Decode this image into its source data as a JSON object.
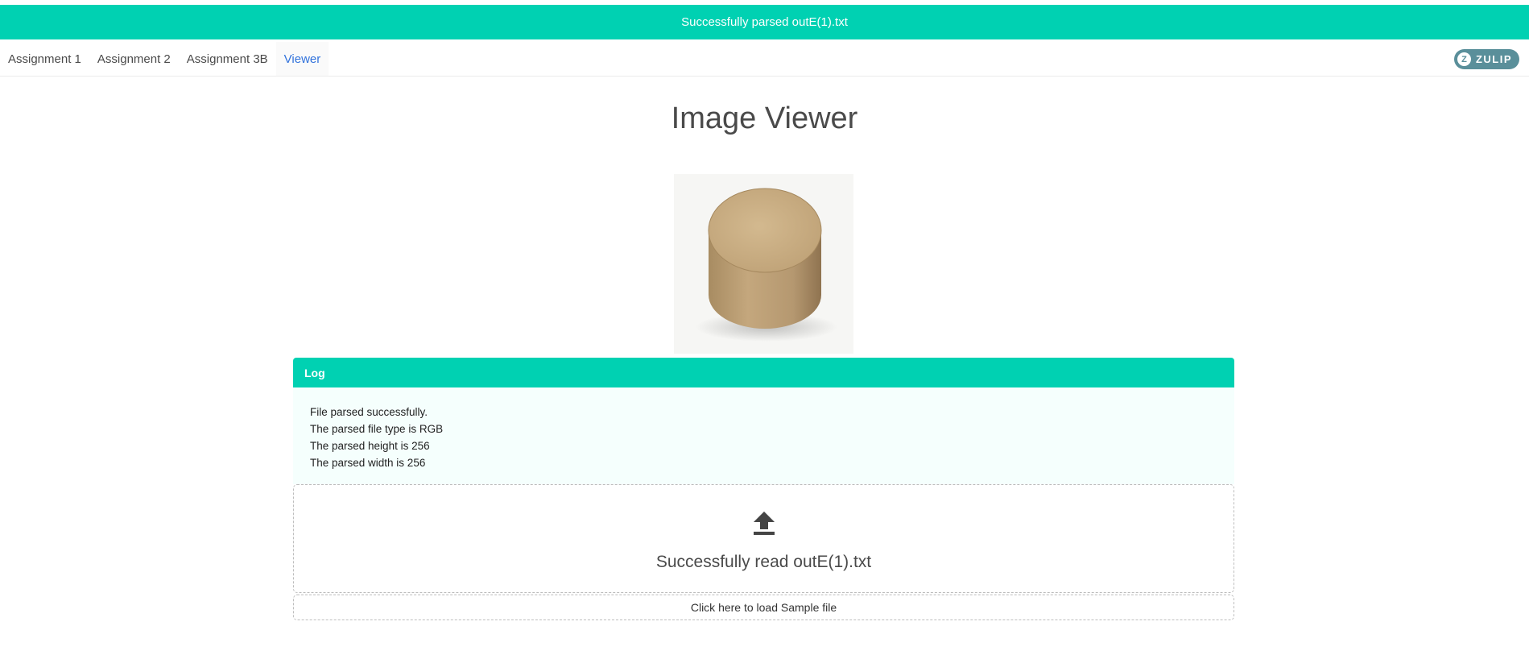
{
  "toast": {
    "message": "Successfully parsed outE(1).txt",
    "color": "#00d1b2"
  },
  "nav": {
    "items": [
      {
        "label": "Assignment 1"
      },
      {
        "label": "Assignment 2"
      },
      {
        "label": "Assignment 3B"
      },
      {
        "label": "Viewer",
        "active": true
      }
    ],
    "brand": {
      "icon": "zulip-icon",
      "label": "ZULIP"
    }
  },
  "page": {
    "title": "Image Viewer"
  },
  "image": {
    "subject": "cardboard-cylinder-box"
  },
  "log": {
    "header": "Log",
    "lines": [
      "File parsed successfully.",
      "The parsed file type is RGB",
      "The parsed height is 256",
      "The parsed width is 256"
    ]
  },
  "dropzone": {
    "icon": "upload-icon",
    "message": "Successfully read outE(1).txt"
  },
  "sample": {
    "label": "Click here to load Sample file"
  }
}
